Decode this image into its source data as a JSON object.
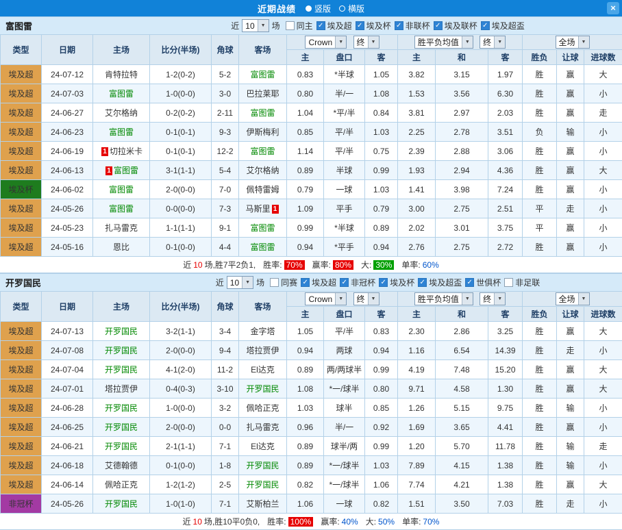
{
  "titlebar": {
    "title": "近期战绩",
    "view_options": [
      {
        "label": "竖版",
        "selected": true
      },
      {
        "label": "横版",
        "selected": false
      }
    ],
    "close": "×"
  },
  "icons": {
    "dropdown": "▼",
    "check": "✓",
    "close": "×"
  },
  "filter_common": {
    "near_label": "近",
    "count_value": "10",
    "matches_label": "场"
  },
  "table_header": {
    "group_columns": [
      "类型",
      "日期",
      "主场",
      "比分(半场)",
      "角球",
      "客场"
    ],
    "asia_select": "Crown",
    "asia_state_select": "终",
    "euro_select": "胜平负均值",
    "euro_state_select": "终",
    "scope_select": "全场",
    "sub_columns": [
      "主",
      "盘口",
      "客",
      "主",
      "和",
      "客",
      "胜负",
      "让球",
      "进球数"
    ]
  },
  "sections": [
    {
      "team": "富图雷",
      "filters": [
        {
          "label": "同主",
          "checked": false
        },
        {
          "label": "埃及超",
          "checked": true
        },
        {
          "label": "埃及杯",
          "checked": true
        },
        {
          "label": "非联杯",
          "checked": true
        },
        {
          "label": "埃及联杯",
          "checked": true
        },
        {
          "label": "埃及超盃",
          "checked": true
        }
      ],
      "rows": [
        {
          "league": "埃及超",
          "style": "orange",
          "date": "24-07-12",
          "home": "肯特拉特",
          "away": "富图雷",
          "away_self": true,
          "score": "1-2(0-2)",
          "corners": "5-2",
          "asia": [
            "0.83",
            "*半球",
            "1.05"
          ],
          "europe": [
            "3.82",
            "3.15",
            "1.97"
          ],
          "result": "胜",
          "handicap_result": "赢",
          "goals_result": "大"
        },
        {
          "league": "埃及超",
          "style": "orange",
          "date": "24-07-03",
          "home": "富图雷",
          "home_self": true,
          "away": "巴拉莱耶",
          "score": "1-0(0-0)",
          "corners": "3-0",
          "asia": [
            "0.80",
            "半/一",
            "1.08"
          ],
          "europe": [
            "1.53",
            "3.56",
            "6.30"
          ],
          "result": "胜",
          "handicap_result": "赢",
          "goals_result": "小"
        },
        {
          "league": "埃及超",
          "style": "orange",
          "date": "24-06-27",
          "home": "艾尔格纳",
          "away": "富图雷",
          "away_self": true,
          "score": "0-2(0-2)",
          "corners": "2-11",
          "asia": [
            "1.04",
            "*平/半",
            "0.84"
          ],
          "europe": [
            "3.81",
            "2.97",
            "2.03"
          ],
          "result": "胜",
          "handicap_result": "赢",
          "goals_result": "走"
        },
        {
          "league": "埃及超",
          "style": "orange",
          "date": "24-06-23",
          "home": "富图雷",
          "home_self": true,
          "away": "伊斯梅利",
          "score": "0-1(0-1)",
          "corners": "9-3",
          "asia": [
            "0.85",
            "平/半",
            "1.03"
          ],
          "europe": [
            "2.25",
            "2.78",
            "3.51"
          ],
          "result": "负",
          "handicap_result": "输",
          "goals_result": "小"
        },
        {
          "league": "埃及超",
          "style": "orange",
          "date": "24-06-19",
          "home": "切拉米卡",
          "home_badge": {
            "text": "1",
            "pos": "left"
          },
          "away": "富图雷",
          "away_self": true,
          "score": "0-1(0-1)",
          "corners": "12-2",
          "asia": [
            "1.14",
            "平/半",
            "0.75"
          ],
          "europe": [
            "2.39",
            "2.88",
            "3.06"
          ],
          "result": "胜",
          "handicap_result": "赢",
          "goals_result": "小"
        },
        {
          "league": "埃及超",
          "style": "orange",
          "date": "24-06-13",
          "home": "富图雷",
          "home_self": true,
          "home_badge": {
            "text": "1",
            "pos": "left"
          },
          "away": "艾尔格纳",
          "score": "3-1(1-1)",
          "corners": "5-4",
          "asia": [
            "0.89",
            "半球",
            "0.99"
          ],
          "europe": [
            "1.93",
            "2.94",
            "4.36"
          ],
          "result": "胜",
          "handicap_result": "赢",
          "goals_result": "大"
        },
        {
          "league": "埃及杯",
          "style": "green",
          "date": "24-06-02",
          "home": "富图雷",
          "home_self": true,
          "away": "佩特雷姆",
          "score": "2-0(0-0)",
          "corners": "7-0",
          "asia": [
            "0.79",
            "一球",
            "1.03"
          ],
          "europe": [
            "1.41",
            "3.98",
            "7.24"
          ],
          "result": "胜",
          "handicap_result": "赢",
          "goals_result": "小"
        },
        {
          "league": "埃及超",
          "style": "orange",
          "date": "24-05-26",
          "home": "富图雷",
          "home_self": true,
          "away": "马斯里",
          "away_badge": {
            "text": "1",
            "pos": "right"
          },
          "score": "0-0(0-0)",
          "corners": "7-3",
          "asia": [
            "1.09",
            "平手",
            "0.79"
          ],
          "europe": [
            "3.00",
            "2.75",
            "2.51"
          ],
          "result": "平",
          "handicap_result": "走",
          "goals_result": "小"
        },
        {
          "league": "埃及超",
          "style": "orange",
          "date": "24-05-23",
          "home": "扎马雷克",
          "away": "富图雷",
          "away_self": true,
          "score": "1-1(1-1)",
          "corners": "9-1",
          "asia": [
            "0.99",
            "*半球",
            "0.89"
          ],
          "europe": [
            "2.02",
            "3.01",
            "3.75"
          ],
          "result": "平",
          "handicap_result": "赢",
          "goals_result": "小"
        },
        {
          "league": "埃及超",
          "style": "orange",
          "date": "24-05-16",
          "home": "恩比",
          "away": "富图雷",
          "away_self": true,
          "score": "0-1(0-0)",
          "corners": "4-4",
          "asia": [
            "0.94",
            "*平手",
            "0.94"
          ],
          "europe": [
            "2.76",
            "2.75",
            "2.72"
          ],
          "result": "胜",
          "handicap_result": "赢",
          "goals_result": "小"
        }
      ],
      "summary": {
        "lead": "近",
        "count": "10",
        "tail": "场,胜7平2负1,",
        "stats": [
          {
            "label": "胜率:",
            "value": "70%",
            "style": "badge-red"
          },
          {
            "label": "赢率:",
            "value": "80%",
            "style": "badge-red"
          },
          {
            "label": "大:",
            "value": "30%",
            "style": "badge-green"
          },
          {
            "label": "单率:",
            "value": "60%",
            "style": "plain-blue"
          }
        ]
      }
    },
    {
      "team": "开罗国民",
      "filters": [
        {
          "label": "同赛",
          "checked": false
        },
        {
          "label": "埃及超",
          "checked": true
        },
        {
          "label": "非冠杯",
          "checked": true
        },
        {
          "label": "埃及杯",
          "checked": true
        },
        {
          "label": "埃及超盃",
          "checked": true
        },
        {
          "label": "世俱杯",
          "checked": true
        },
        {
          "label": "非足联",
          "checked": false
        }
      ],
      "rows": [
        {
          "league": "埃及超",
          "style": "orange",
          "date": "24-07-13",
          "home": "开罗国民",
          "home_self": true,
          "away": "金字塔",
          "score": "3-2(1-1)",
          "corners": "3-4",
          "asia": [
            "1.05",
            "平/半",
            "0.83"
          ],
          "europe": [
            "2.30",
            "2.86",
            "3.25"
          ],
          "result": "胜",
          "handicap_result": "赢",
          "goals_result": "大"
        },
        {
          "league": "埃及超",
          "style": "orange",
          "date": "24-07-08",
          "home": "开罗国民",
          "home_self": true,
          "away": "塔拉贾伊",
          "score": "2-0(0-0)",
          "corners": "9-4",
          "asia": [
            "0.94",
            "两球",
            "0.94"
          ],
          "europe": [
            "1.16",
            "6.54",
            "14.39"
          ],
          "result": "胜",
          "handicap_result": "走",
          "goals_result": "小"
        },
        {
          "league": "埃及超",
          "style": "orange",
          "date": "24-07-04",
          "home": "开罗国民",
          "home_self": true,
          "away": "El达克",
          "score": "4-1(2-0)",
          "corners": "11-2",
          "asia": [
            "0.89",
            "两/两球半",
            "0.99"
          ],
          "europe": [
            "4.19",
            "7.48",
            "15.20"
          ],
          "result": "胜",
          "handicap_result": "赢",
          "goals_result": "大"
        },
        {
          "league": "埃及超",
          "style": "orange",
          "date": "24-07-01",
          "home": "塔拉贾伊",
          "away": "开罗国民",
          "away_self": true,
          "score": "0-4(0-3)",
          "corners": "3-10",
          "asia": [
            "1.08",
            "*一/球半",
            "0.80"
          ],
          "europe": [
            "9.71",
            "4.58",
            "1.30"
          ],
          "result": "胜",
          "handicap_result": "赢",
          "goals_result": "大"
        },
        {
          "league": "埃及超",
          "style": "orange",
          "date": "24-06-28",
          "home": "开罗国民",
          "home_self": true,
          "away": "佩哈正克",
          "score": "1-0(0-0)",
          "corners": "3-2",
          "asia": [
            "1.03",
            "球半",
            "0.85"
          ],
          "europe": [
            "1.26",
            "5.15",
            "9.75"
          ],
          "result": "胜",
          "handicap_result": "输",
          "goals_result": "小"
        },
        {
          "league": "埃及超",
          "style": "orange",
          "date": "24-06-25",
          "home": "开罗国民",
          "home_self": true,
          "away": "扎马雷克",
          "score": "2-0(0-0)",
          "corners": "0-0",
          "asia": [
            "0.96",
            "半/一",
            "0.92"
          ],
          "europe": [
            "1.69",
            "3.65",
            "4.41"
          ],
          "result": "胜",
          "handicap_result": "赢",
          "goals_result": "小"
        },
        {
          "league": "埃及超",
          "style": "orange",
          "date": "24-06-21",
          "home": "开罗国民",
          "home_self": true,
          "away": "El达克",
          "score": "2-1(1-1)",
          "corners": "7-1",
          "asia": [
            "0.89",
            "球半/两",
            "0.99"
          ],
          "europe": [
            "1.20",
            "5.70",
            "11.78"
          ],
          "result": "胜",
          "handicap_result": "输",
          "goals_result": "走"
        },
        {
          "league": "埃及超",
          "style": "orange",
          "date": "24-06-18",
          "home": "艾德翰德",
          "away": "开罗国民",
          "away_self": true,
          "score": "0-1(0-0)",
          "corners": "1-8",
          "asia": [
            "0.89",
            "*一/球半",
            "1.03"
          ],
          "europe": [
            "7.89",
            "4.15",
            "1.38"
          ],
          "result": "胜",
          "handicap_result": "输",
          "goals_result": "小"
        },
        {
          "league": "埃及超",
          "style": "orange",
          "date": "24-06-14",
          "home": "佩哈正克",
          "away": "开罗国民",
          "away_self": true,
          "score": "1-2(1-2)",
          "corners": "2-5",
          "asia": [
            "0.82",
            "*一/球半",
            "1.06"
          ],
          "europe": [
            "7.74",
            "4.21",
            "1.38"
          ],
          "result": "胜",
          "handicap_result": "赢",
          "goals_result": "大"
        },
        {
          "league": "非冠杯",
          "style": "purple",
          "date": "24-05-26",
          "home": "开罗国民",
          "home_self": true,
          "away": "艾斯柏兰",
          "score": "1-0(1-0)",
          "corners": "7-1",
          "asia": [
            "1.06",
            "一球",
            "0.82"
          ],
          "europe": [
            "1.51",
            "3.50",
            "7.03"
          ],
          "result": "胜",
          "handicap_result": "走",
          "goals_result": "小"
        }
      ],
      "summary": {
        "lead": "近",
        "count": "10",
        "tail": "场,胜10平0负0,",
        "stats": [
          {
            "label": "胜率:",
            "value": "100%",
            "style": "badge-red"
          },
          {
            "label": "赢率:",
            "value": "40%",
            "style": "plain-blue"
          },
          {
            "label": "大:",
            "value": "50%",
            "style": "plain-blue"
          },
          {
            "label": "单率:",
            "value": "70%",
            "style": "plain-blue"
          }
        ]
      }
    }
  ]
}
